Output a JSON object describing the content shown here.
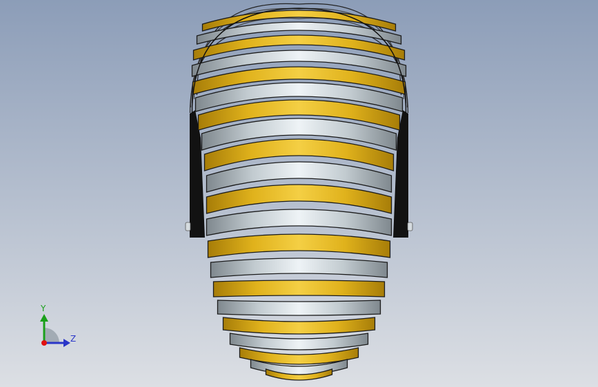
{
  "viewport": {
    "background_top": "#8c9db8",
    "background_bottom": "#dcdfe4",
    "model": {
      "part": "flexible-bellows-duct",
      "band_colors": {
        "gold": "#e8bb22",
        "gold_dark": "#b68a0c",
        "silver": "#dfe6ea",
        "silver_dark": "#8c969c",
        "bracket": "#121212"
      }
    }
  },
  "triad": {
    "y_label": "Y",
    "z_label": "Z",
    "y_color": "#1aa01a",
    "z_color": "#2a36c8",
    "origin_color": "#e01010"
  }
}
